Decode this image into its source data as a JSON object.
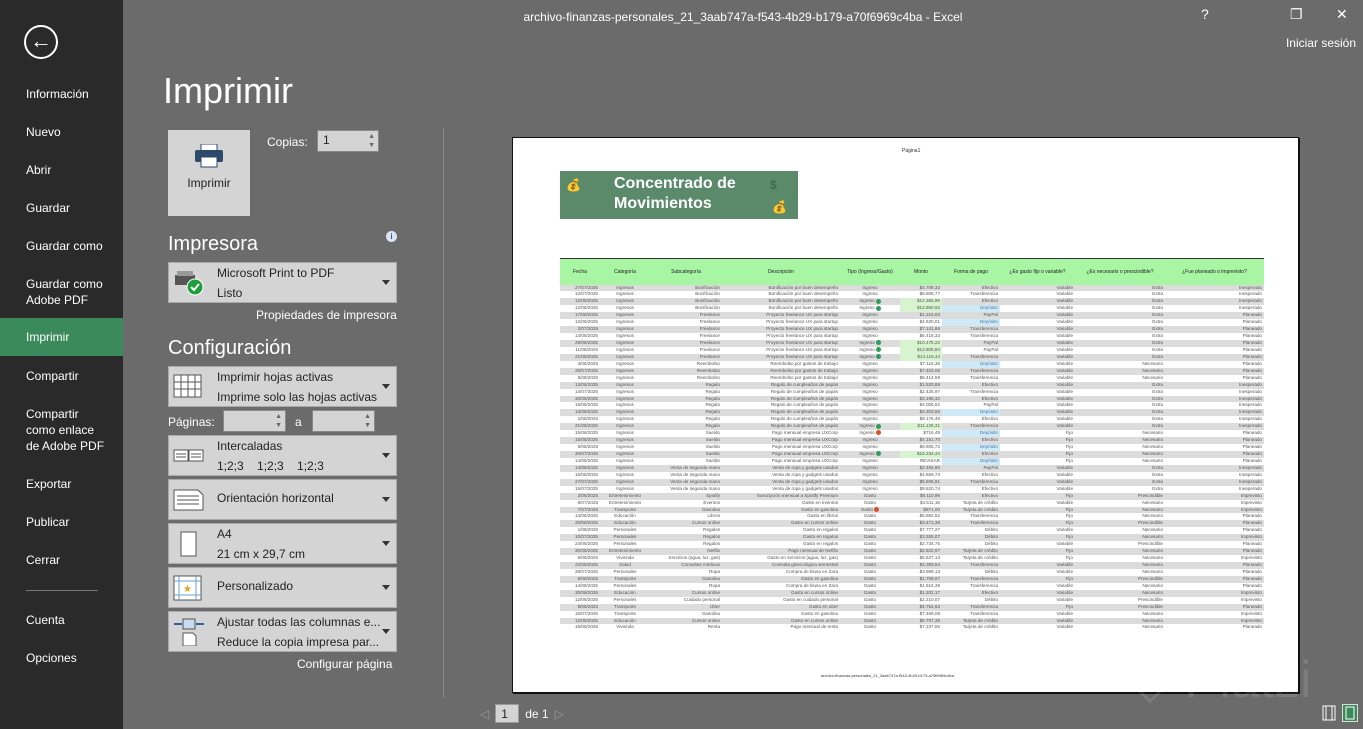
{
  "window": {
    "title": "archivo-finanzas-personales_21_3aab747a-f543-4b29-b179-a70f6969c4ba - Excel",
    "help": "?",
    "restore": "❐",
    "close": "✕",
    "sign_in": "Iniciar sesión"
  },
  "sidebar": {
    "back": "←",
    "items": [
      {
        "label": "Información"
      },
      {
        "label": "Nuevo"
      },
      {
        "label": "Abrir"
      },
      {
        "label": "Guardar"
      },
      {
        "label": "Guardar como"
      },
      {
        "label": "Guardar como Adobe PDF"
      },
      {
        "label": "Imprimir",
        "selected": true
      },
      {
        "label": "Compartir"
      },
      {
        "label": "Compartir como enlace de Adobe PDF"
      },
      {
        "label": "Exportar"
      },
      {
        "label": "Publicar"
      },
      {
        "label": "Cerrar"
      },
      {
        "label": "Cuenta"
      },
      {
        "label": "Opciones"
      }
    ]
  },
  "print": {
    "title": "Imprimir",
    "button": "Imprimir",
    "copies_label": "Copias:",
    "copies": "1",
    "printer_section": "Impresora",
    "printer_name": "Microsoft Print to PDF",
    "printer_status": "Listo",
    "printer_props": "Propiedades de impresora",
    "config_section": "Configuración",
    "what": {
      "t1": "Imprimir hojas activas",
      "t2": "Imprime solo las hojas activas"
    },
    "pages_label": "Páginas:",
    "pages_to": "a",
    "pages_from_value": "",
    "pages_to_value": "",
    "collate": {
      "t1": "Intercaladas",
      "t2": "1;2;3    1;2;3    1;2;3"
    },
    "orientation": "Orientación horizontal",
    "paper": {
      "t1": "A4",
      "t2": "21 cm x 29,7 cm"
    },
    "margins": "Personalizado",
    "scaling": {
      "t1": "Ajustar todas las columnas e...",
      "t2": "Reduce la copia impresa par..."
    },
    "page_setup": "Configurar página"
  },
  "preview": {
    "page_header": "Página1",
    "banner": "Concentrado de Movimientos",
    "footer": "archivo-finanzas-personales_21_3aab747a-f543-4b29-b179-a70f6969c4ba",
    "page": "1",
    "of": "de 1",
    "watermark": "Platzi",
    "headers": [
      "Fecha",
      "Categoría",
      "Subcategoría",
      "Descripción",
      "Tipo (Ingreso/Gasto)",
      "Monto",
      "Forma de pago",
      "¿Es gasto fijo o variable?",
      "¿Es necesario o prescindible?",
      "¿Fue planeado o imprevisto?"
    ],
    "rows": [
      [
        "27/07/2025",
        "Ingresos",
        "Bonificación",
        "Bonificación por buen desempeño",
        "Ingreso",
        "$4.709,33",
        "Efectivo",
        "Variable",
        "Extra",
        "Inesperado",
        ""
      ],
      [
        "12/07/2025",
        "Ingresos",
        "Bonificación",
        "Bonificación por buen desempeño",
        "Ingreso",
        "$6.808,77",
        "Transferencia",
        "Variable",
        "Extra",
        "Inesperado",
        ""
      ],
      [
        "12/08/2025",
        "Ingresos",
        "Bonificación",
        "Bonificación por buen desempeño",
        "Ingreso",
        "$12.365,99",
        "Efectivo",
        "Variable",
        "Extra",
        "Inesperado",
        "up"
      ],
      [
        "12/08/2025",
        "Ingresos",
        "Bonificación",
        "Bonificación por buen desempeño",
        "Ingreso",
        "$12.960,63",
        "Depósito",
        "Variable",
        "Extra",
        "Inesperado",
        "up"
      ],
      [
        "17/08/2025",
        "Ingresos",
        "Freelance",
        "Proyecto freelance UX para startup",
        "Ingreso",
        "$1.215,63",
        "PayPal",
        "Variable",
        "Extra",
        "Planeado",
        ""
      ],
      [
        "12/06/2025",
        "Ingresos",
        "Freelance",
        "Proyecto freelance UX para startup",
        "Ingreso",
        "$4.620,01",
        "Depósito",
        "Variable",
        "Extra",
        "Planeado",
        ""
      ],
      [
        "2/07/2025",
        "Ingresos",
        "Freelance",
        "Proyecto freelance UX para startup",
        "Ingreso",
        "$7.141,66",
        "Transferencia",
        "Variable",
        "Extra",
        "Planeado",
        ""
      ],
      [
        "14/06/2025",
        "Ingresos",
        "Freelance",
        "Proyecto freelance UX para startup",
        "Ingreso",
        "$6.416,33",
        "Transferencia",
        "Variable",
        "Extra",
        "Planeado",
        ""
      ],
      [
        "29/08/2025",
        "Ingresos",
        "Freelance",
        "Proyecto freelance UX para startup",
        "Ingreso",
        "$10.475,23",
        "PayPal",
        "Variable",
        "Extra",
        "Planeado",
        "up"
      ],
      [
        "11/08/2025",
        "Ingresos",
        "Freelance",
        "Proyecto freelance UX para startup",
        "Ingreso",
        "$12.606,84",
        "PayPal",
        "Variable",
        "Extra",
        "Planeado",
        "up"
      ],
      [
        "21/08/2025",
        "Ingresos",
        "Freelance",
        "Proyecto freelance UX para startup",
        "Ingreso",
        "$14.118,44",
        "Transferencia",
        "Variable",
        "Extra",
        "Planeado",
        "up"
      ],
      [
        "4/06/2025",
        "Ingresos",
        "Reembolso",
        "Reembolso por gastos de trabajo",
        "Ingreso",
        "$7.116,39",
        "Depósito",
        "Variable",
        "Necesario",
        "Planeado",
        ""
      ],
      [
        "28/07/2025",
        "Ingresos",
        "Reembolso",
        "Reembolso por gastos de trabajo",
        "Ingreso",
        "$7.403,06",
        "Transferencia",
        "Variable",
        "Necesario",
        "Planeado",
        ""
      ],
      [
        "5/08/2025",
        "Ingresos",
        "Reembolso",
        "Reembolso por gastos de trabajo",
        "Ingreso",
        "$6.414,59",
        "Transferencia",
        "Variable",
        "Necesario",
        "Planeado",
        ""
      ],
      [
        "13/06/2025",
        "Ingresos",
        "Regalo",
        "Regalo de cumpleaños de papás",
        "Ingreso",
        "$1.520,69",
        "Efectivo",
        "Variable",
        "Extra",
        "Inesperado",
        ""
      ],
      [
        "14/07/2025",
        "Ingresos",
        "Regalo",
        "Regalo de cumpleaños de papás",
        "Ingreso",
        "$2.425,97",
        "Transferencia",
        "Variable",
        "Extra",
        "Inesperado",
        ""
      ],
      [
        "30/06/2025",
        "Ingresos",
        "Regalo",
        "Regalo de cumpleaños de papás",
        "Ingreso",
        "$3.198,32",
        "Efectivo",
        "Variable",
        "Extra",
        "Inesperado",
        ""
      ],
      [
        "18/06/2025",
        "Ingresos",
        "Regalo",
        "Regalo de cumpleaños de papás",
        "Ingreso",
        "$4.005,52",
        "PayPal",
        "Variable",
        "Extra",
        "Inesperado",
        ""
      ],
      [
        "13/08/2025",
        "Ingresos",
        "Regalo",
        "Regalo de cumpleaños de papás",
        "Ingreso",
        "$4.303,65",
        "Depósito",
        "Variable",
        "Extra",
        "Inesperado",
        ""
      ],
      [
        "1/08/2025",
        "Ingresos",
        "Regalo",
        "Regalo de cumpleaños de papás",
        "Ingreso",
        "$9.175,46",
        "Efectivo",
        "Variable",
        "Extra",
        "Inesperado",
        ""
      ],
      [
        "21/08/2025",
        "Ingresos",
        "Regalo",
        "Regalo de cumpleaños de papás",
        "Ingreso",
        "$11.125,31",
        "Transferencia",
        "Variable",
        "Extra",
        "Inesperado",
        "up"
      ],
      [
        "15/06/2025",
        "Ingresos",
        "Sueldo",
        "Pago mensual empresa UXCorp",
        "Ingreso",
        "$716,49",
        "Depósito",
        "Fijo",
        "Necesario",
        "Planeado",
        "down"
      ],
      [
        "15/08/2025",
        "Ingresos",
        "Sueldo",
        "Pago mensual empresa UXCorp",
        "Ingreso",
        "$4.151,70",
        "Efectivo",
        "Fijo",
        "Necesario",
        "Planeado",
        ""
      ],
      [
        "5/08/2025",
        "Ingresos",
        "Sueldo",
        "Pago mensual empresa UXCorp",
        "Ingreso",
        "$9.605,72",
        "Depósito",
        "Fijo",
        "Necesario",
        "Planeado",
        ""
      ],
      [
        "30/07/2025",
        "Ingresos",
        "Sueldo",
        "Pago mensual empresa UXCorp",
        "Ingreso",
        "$16.234,44",
        "Efectivo",
        "Fijo",
        "Necesario",
        "Planeado",
        "up"
      ],
      [
        "14/06/2025",
        "Ingresos",
        "Sueldo",
        "Pago mensual empresa UXCorp",
        "Ingreso",
        "REVISAR",
        "Depósito",
        "Fijo",
        "Necesario",
        "Planeado",
        ""
      ],
      [
        "14/08/2025",
        "Ingresos",
        "Venta de segunda mano",
        "Venta de ropa y gadgets usados",
        "Ingreso",
        "$2.464,60",
        "PayPal",
        "Variable",
        "Extra",
        "Inesperado",
        ""
      ],
      [
        "15/08/2025",
        "Ingresos",
        "Venta de segunda mano",
        "Venta de ropa y gadgets usados",
        "Ingreso",
        "$4.659,73",
        "Efectivo",
        "Variable",
        "Extra",
        "Inesperado",
        ""
      ],
      [
        "27/07/2025",
        "Ingresos",
        "Venta de segunda mano",
        "Venta de ropa y gadgets usados",
        "Ingreso",
        "$5.505,91",
        "Transferencia",
        "Variable",
        "Extra",
        "Inesperado",
        ""
      ],
      [
        "15/07/2025",
        "Ingresos",
        "Venta de segunda mano",
        "Venta de ropa y gadgets usados",
        "Ingreso",
        "$9.620,74",
        "Efectivo",
        "Variable",
        "Extra",
        "Inesperado",
        ""
      ],
      [
        "2/06/2025",
        "Entretenimiento",
        "Spotify",
        "Suscripción mensual a Spotify Premium",
        "Gasto",
        "$5.110,99",
        "Efectivo",
        "Fijo",
        "Prescindible",
        "Imprevisto",
        ""
      ],
      [
        "6/07/2025",
        "Entretenimiento",
        "Eventos",
        "Gasto en eventos",
        "Gasto",
        "$4.511,16",
        "Tarjeta de crédito",
        "Variable",
        "Necesario",
        "Imprevisto",
        ""
      ],
      [
        "7/07/2025",
        "Transporte",
        "Gasolina",
        "Gasto en gasolina",
        "Gasto",
        "$871,00",
        "Tarjeta de crédito",
        "Fijo",
        "Necesario",
        "Imprevisto",
        "down"
      ],
      [
        "14/06/2025",
        "Educación",
        "Libros",
        "Gasto en libros",
        "Gasto",
        "$5.862,52",
        "Transferencia",
        "Fijo",
        "Necesario",
        "Planeado",
        ""
      ],
      [
        "20/08/2025",
        "Educación",
        "Cursos online",
        "Gasto en cursos online",
        "Gasto",
        "$3.471,38",
        "Transferencia",
        "Fijo",
        "Prescindible",
        "Planeado",
        ""
      ],
      [
        "1/08/2025",
        "Personales",
        "Regalos",
        "Gasto en regalos",
        "Gasto",
        "$7.777,27",
        "Débito",
        "Variable",
        "Necesario",
        "Planeado",
        ""
      ],
      [
        "10/07/2025",
        "Personales",
        "Regalos",
        "Gasto en regalos",
        "Gasto",
        "$3.265,07",
        "Débito",
        "Fijo",
        "Necesario",
        "Imprevisto",
        ""
      ],
      [
        "24/06/2025",
        "Personales",
        "Regalos",
        "Gasto en regalos",
        "Gasto",
        "$2.734,75",
        "Débito",
        "Variable",
        "Prescindible",
        "Planeado",
        ""
      ],
      [
        "30/06/2025",
        "Entretenimiento",
        "Netflix",
        "Pago mensual de Netflix",
        "Gasto",
        "$2.622,87",
        "Tarjeta de crédito",
        "Fijo",
        "Necesario",
        "Planeado",
        ""
      ],
      [
        "5/06/2025",
        "Vivienda",
        "Servicios (agua, luz, gas)",
        "Gasto en servicios (agua, luz, gas)",
        "Gasto",
        "$5.527,13",
        "Tarjeta de crédito",
        "Fijo",
        "Necesario",
        "Imprevisto",
        ""
      ],
      [
        "22/08/2025",
        "Salud",
        "Consultas médicas",
        "Consulta ginecológica semestral",
        "Gasto",
        "$4.393,54",
        "Transferencia",
        "Variable",
        "Necesario",
        "Planeado",
        ""
      ],
      [
        "28/07/2025",
        "Personales",
        "Ropa",
        "Compra de blusa en Zara",
        "Gasto",
        "$3.889,13",
        "Débito",
        "Variable",
        "Necesario",
        "Planeado",
        ""
      ],
      [
        "6/08/2025",
        "Transporte",
        "Gasolina",
        "Gasto en gasolina",
        "Gasto",
        "$1.759,67",
        "Transferencia",
        "Fijo",
        "Prescindible",
        "Planeado",
        ""
      ],
      [
        "14/08/2025",
        "Personales",
        "Ropa",
        "Compra de blusa en Zara",
        "Gasto",
        "$1.516,39",
        "Transferencia",
        "Variable",
        "Necesario",
        "Planeado",
        ""
      ],
      [
        "30/08/2025",
        "Educación",
        "Cursos online",
        "Gasto en cursos online",
        "Gasto",
        "$1.202,17",
        "Efectivo",
        "Variable",
        "Necesario",
        "Imprevisto",
        ""
      ],
      [
        "12/06/2025",
        "Personales",
        "Cuidado personal",
        "Gasto en cuidado personal",
        "Gasto",
        "$2.210,07",
        "Débito",
        "Variable",
        "Prescindible",
        "Imprevisto",
        ""
      ],
      [
        "8/06/2025",
        "Transporte",
        "Uber",
        "Gasto en uber",
        "Gasto",
        "$4.754,63",
        "Transferencia",
        "Fijo",
        "Prescindible",
        "Planeado",
        ""
      ],
      [
        "15/07/2025",
        "Transporte",
        "Gasolina",
        "Gasto en gasolina",
        "Gasto",
        "$7.469,08",
        "Transferencia",
        "Variable",
        "Necesario",
        "Imprevisto",
        ""
      ],
      [
        "12/08/2025",
        "Educación",
        "Cursos online",
        "Gasto en cursos online",
        "Gasto",
        "$5.707,35",
        "Tarjeta de crédito",
        "Variable",
        "Necesario",
        "Imprevisto",
        ""
      ],
      [
        "18/06/2025",
        "Vivienda",
        "Renta",
        "Pago mensual de renta",
        "Gasto",
        "$7.237,65",
        "Tarjeta de crédito",
        "Variable",
        "Necesario",
        "Planeado",
        ""
      ]
    ]
  },
  "colors": {
    "sidebar": "#2a2a2a",
    "selected": "#3b8a5c",
    "header_green": "#a8f5a3",
    "up": "#2f9e5a",
    "down": "#d9502a"
  }
}
